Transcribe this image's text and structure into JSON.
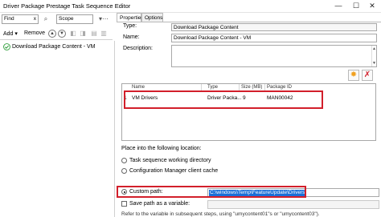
{
  "window": {
    "title": "Driver Package Prestage Task Sequence Editor",
    "minimize": "—",
    "maximize": "☐",
    "close": "✕"
  },
  "toolbar": {
    "find_value": "Find",
    "find_clear": "x",
    "scope_value": "Scope",
    "add_label": "Add ▾",
    "remove_label": "Remove"
  },
  "tree": {
    "items": [
      {
        "label": "Download Package Content - VM"
      }
    ]
  },
  "tabs": [
    {
      "label": "Properties",
      "active": true
    },
    {
      "label": "Options",
      "active": false
    }
  ],
  "properties": {
    "type_label": "Type:",
    "type_value": "Download Package Content",
    "name_label": "Name:",
    "name_value": "Download Package Content - VM",
    "description_label": "Description:",
    "description_value": ""
  },
  "actions": {
    "add_icon": "add-package-icon",
    "delete_icon": "delete-icon",
    "accent": "#f0a020",
    "delete_color": "#d21f2b"
  },
  "package_table": {
    "columns": [
      "Name",
      "Type",
      "Size (MB)",
      "Package ID"
    ],
    "rows": [
      {
        "index": "1",
        "name": "VM Drivers",
        "type": "Driver Packa...",
        "size": "9",
        "package_id": "MAN00042"
      }
    ]
  },
  "location": {
    "heading": "Place into the following location:",
    "options": [
      {
        "label": "Task sequence working directory",
        "selected": false
      },
      {
        "label": "Configuration Manager client cache",
        "selected": false
      },
      {
        "label": "Custom path:",
        "selected": true
      }
    ],
    "custom_path_value": "C:\\windows\\Temp\\FeatureUpdate\\Drivers"
  },
  "save_variable": {
    "label": "Save path as a variable:",
    "checked": false
  },
  "footnote": "Refer to the variable in subsequent steps, using \"umycontent01\"s or \"umycontent03\")."
}
